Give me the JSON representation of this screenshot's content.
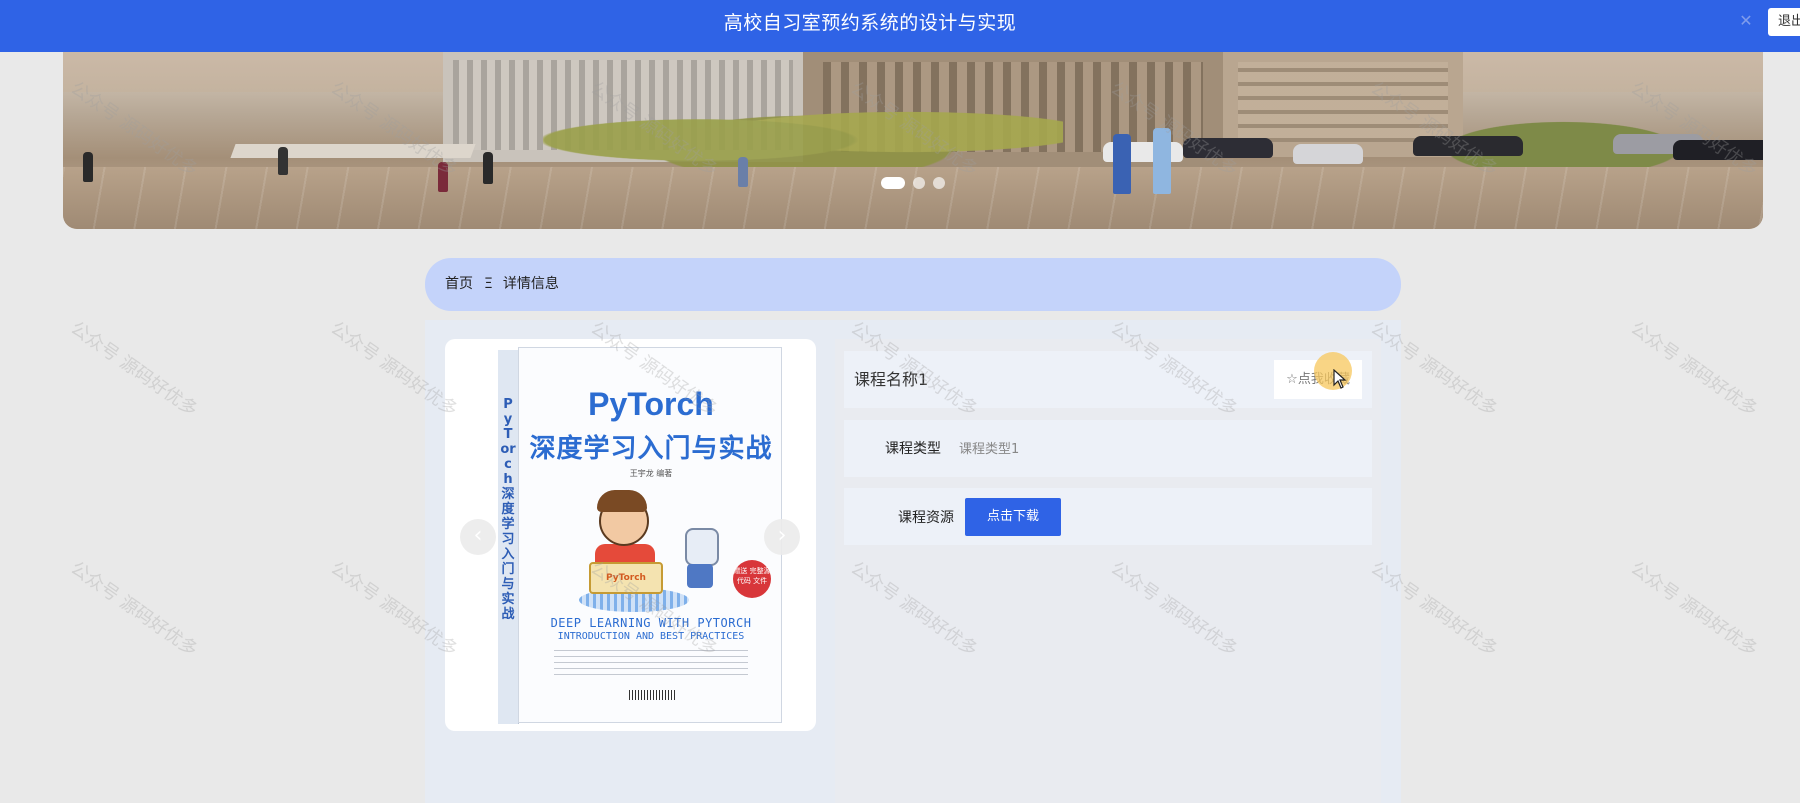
{
  "header": {
    "title": "高校自习室预约系统的设计与实现",
    "logout_label": "退出",
    "close_icon": "x-icon"
  },
  "banner": {
    "slides": 3,
    "active_slide": 1
  },
  "breadcrumb": {
    "home": "首页",
    "separator": "Ξ",
    "current": "详情信息"
  },
  "gallery": {
    "prev_icon": "chevron-left-icon",
    "next_icon": "chevron-right-icon",
    "book": {
      "spine": "PyTorch深度学习入门与实战",
      "title": "PyTorch",
      "subtitle": "深度学习入门与实战",
      "author": "王宇龙  编著",
      "illus_label": "PyTorch",
      "badge": "赠送 完整源代码 文件",
      "english_1": "DEEP LEARNING WITH PYTORCH",
      "english_2": "INTRODUCTION AND BEST PRACTICES"
    }
  },
  "detail": {
    "course_name": "课程名称1",
    "favorite_label": "☆点我收藏",
    "type_label": "课程类型",
    "type_value": "课程类型1",
    "resource_label": "课程资源",
    "download_label": "点击下载"
  },
  "watermark": "公众号 源码好优多",
  "colors": {
    "header": "#2f63e6",
    "breadcrumb_bg": "#c4d3fa",
    "button": "#2f63e6",
    "page_bg": "#e9e9e9"
  }
}
